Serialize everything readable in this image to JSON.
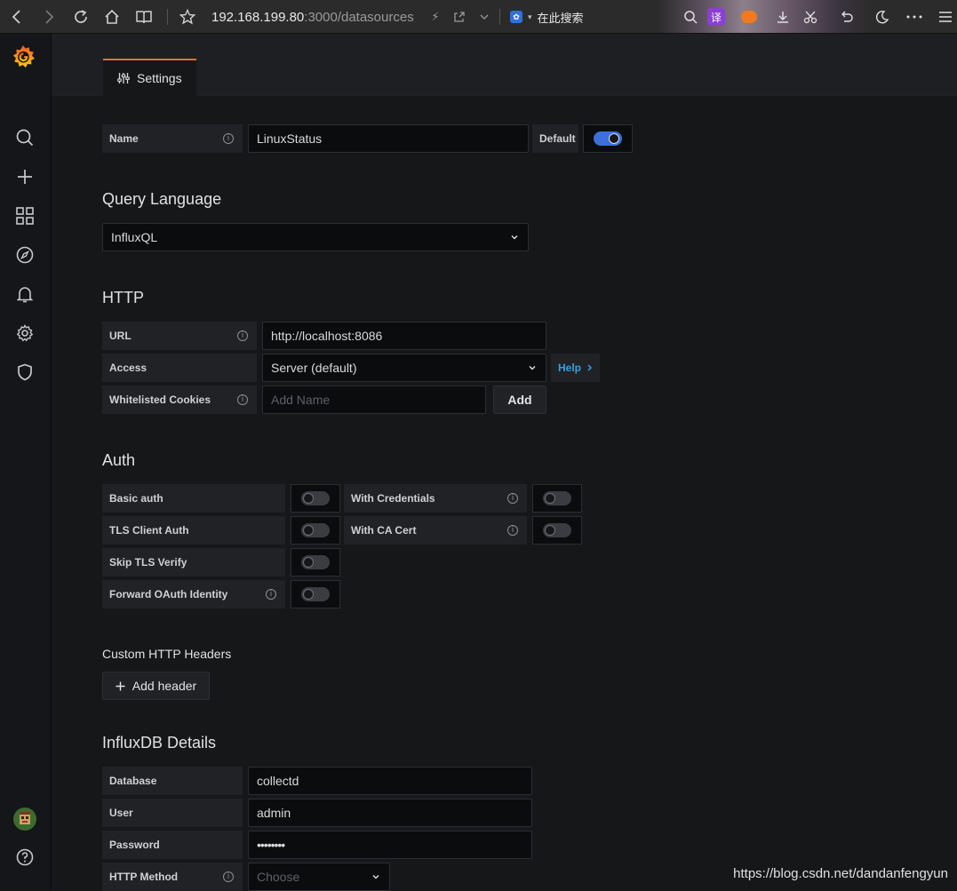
{
  "browser": {
    "url_host": "192.168.199.80",
    "url_rest": ":3000/datasources/",
    "search_label": "在此搜索",
    "translate_label": "译"
  },
  "tab": {
    "label": "Settings"
  },
  "name_row": {
    "label": "Name",
    "value": "LinuxStatus",
    "default_label": "Default",
    "default_on": true
  },
  "query_language": {
    "title": "Query Language",
    "value": "InfluxQL"
  },
  "http": {
    "title": "HTTP",
    "url_label": "URL",
    "url_value": "http://localhost:8086",
    "access_label": "Access",
    "access_value": "Server (default)",
    "help_label": "Help",
    "cookies_label": "Whitelisted Cookies",
    "cookies_placeholder": "Add Name",
    "add_label": "Add"
  },
  "auth": {
    "title": "Auth",
    "basic": "Basic auth",
    "with_credentials": "With Credentials",
    "tls_client": "TLS Client Auth",
    "with_ca": "With CA Cert",
    "skip_tls": "Skip TLS Verify",
    "forward_oauth": "Forward OAuth Identity"
  },
  "custom_headers": {
    "title": "Custom HTTP Headers",
    "add_label": "Add header"
  },
  "influx": {
    "title": "InfluxDB Details",
    "database_label": "Database",
    "database_value": "collectd",
    "user_label": "User",
    "user_value": "admin",
    "password_label": "Password",
    "password_value": "••••••••",
    "method_label": "HTTP Method",
    "method_placeholder": "Choose"
  },
  "watermark": "https://blog.csdn.net/dandanfengyun",
  "colors": {
    "accent": "#3d71d9",
    "tab_border": "#f0712d",
    "help": "#33a2e5"
  }
}
